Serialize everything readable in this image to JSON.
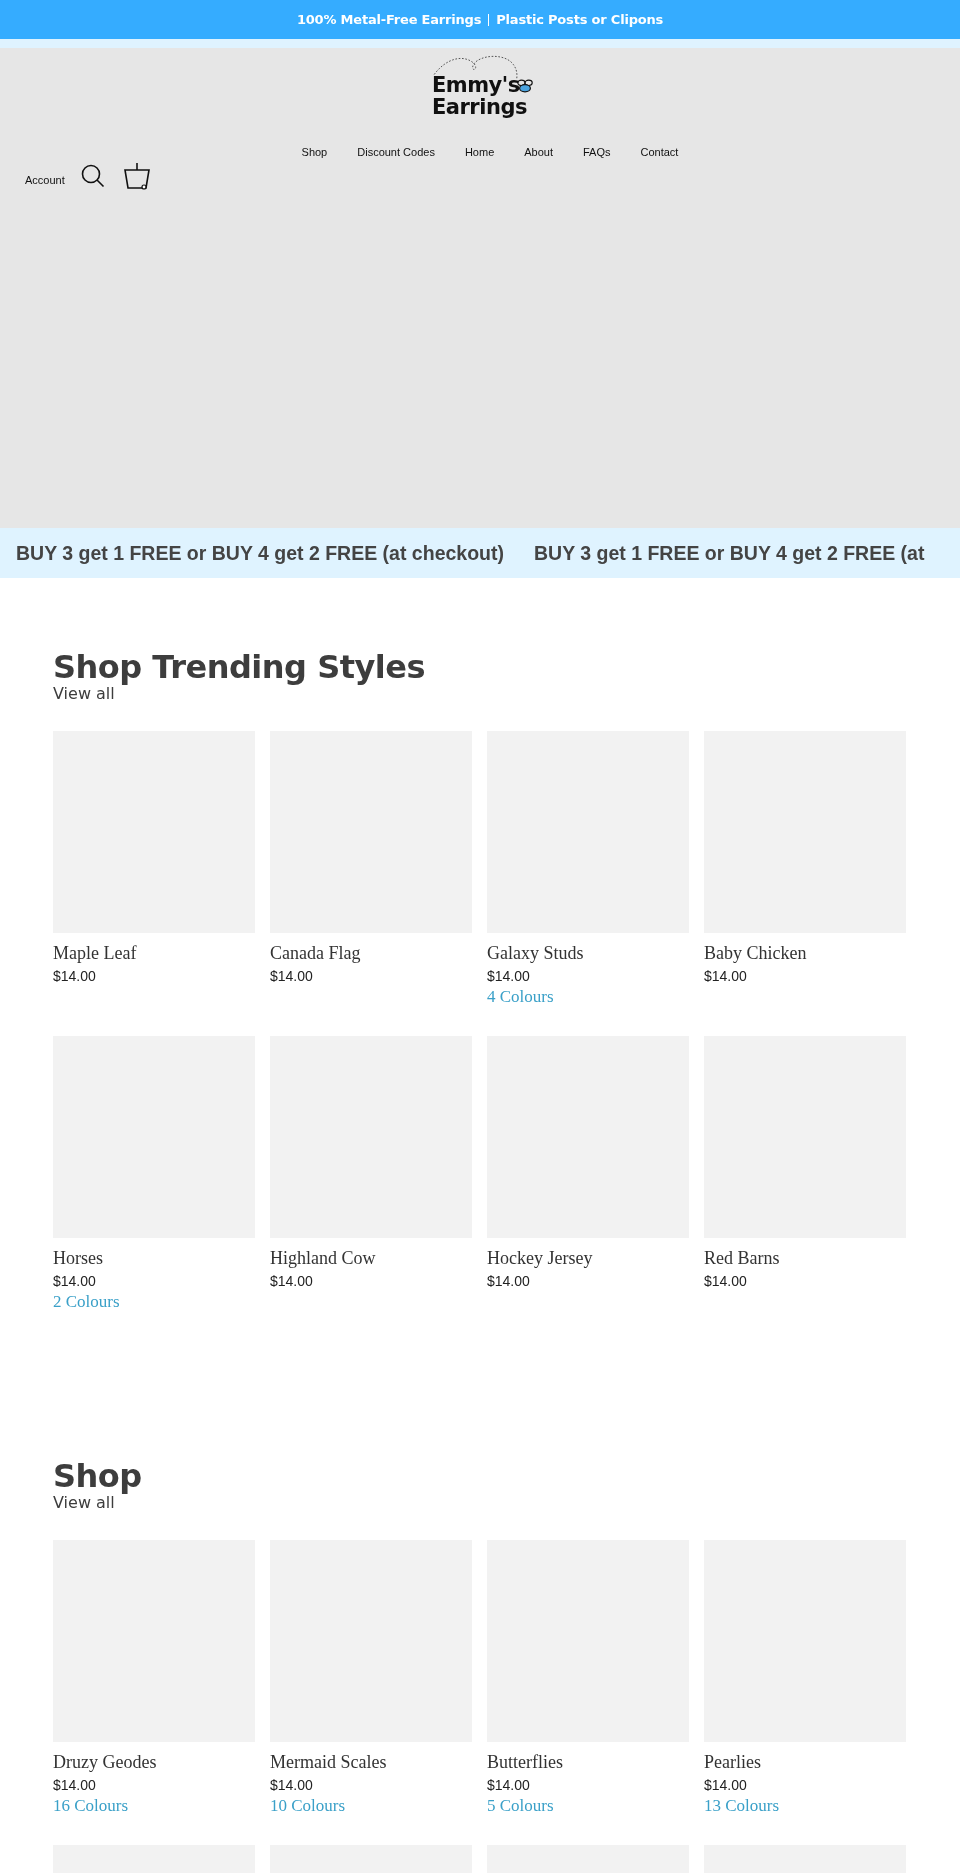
{
  "announcement": {
    "parts": [
      "100% Metal-Free Earrings",
      "Plastic Posts or Clipons"
    ]
  },
  "logo": {
    "text": "Emmy's Earrings"
  },
  "nav": [
    {
      "label": "Shop"
    },
    {
      "label": "Discount Codes"
    },
    {
      "label": "Home"
    },
    {
      "label": "About"
    },
    {
      "label": "FAQs"
    },
    {
      "label": "Contact"
    }
  ],
  "account": {
    "label": "Account"
  },
  "marquee": {
    "texts": [
      "BUY 3 get 1 FREE or BUY 4 get 2 FREE (at checkout)",
      "BUY 3 get 1 FREE or BUY 4 get 2 FREE (at"
    ]
  },
  "sections": [
    {
      "title": "Shop Trending Styles",
      "link": "View all",
      "products": [
        {
          "kind": "product",
          "name": "Maple Leaf",
          "price": "$14.00"
        },
        {
          "kind": "product",
          "name": "Canada Flag",
          "price": "$14.00"
        },
        {
          "kind": "product",
          "name": "Galaxy Studs",
          "price": "$14.00",
          "colours": "4 Colours"
        },
        {
          "kind": "product",
          "name": "Baby Chicken",
          "price": "$14.00"
        },
        {
          "kind": "product",
          "name": "Horses",
          "price": "$14.00",
          "colours": "2 Colours"
        },
        {
          "kind": "product",
          "name": "Highland Cow",
          "price": "$14.00"
        },
        {
          "kind": "product",
          "name": "Hockey Jersey",
          "price": "$14.00"
        },
        {
          "kind": "product",
          "name": "Red Barns",
          "price": "$14.00"
        }
      ]
    },
    {
      "title": "Shop",
      "link": "View all",
      "products": [
        {
          "kind": "product",
          "name": "Druzy Geodes",
          "price": "$14.00",
          "colours": "16 Colours"
        },
        {
          "kind": "product",
          "name": "Mermaid Scales",
          "price": "$14.00",
          "colours": "10 Colours"
        },
        {
          "kind": "product",
          "name": "Butterflies",
          "price": "$14.00",
          "colours": "5 Colours"
        },
        {
          "kind": "product",
          "name": "Pearlies",
          "price": "$14.00",
          "colours": "13 Colours"
        },
        {
          "kind": "image_only"
        },
        {
          "kind": "image_only"
        },
        {
          "kind": "image_only"
        },
        {
          "kind": "image_only"
        }
      ]
    }
  ]
}
